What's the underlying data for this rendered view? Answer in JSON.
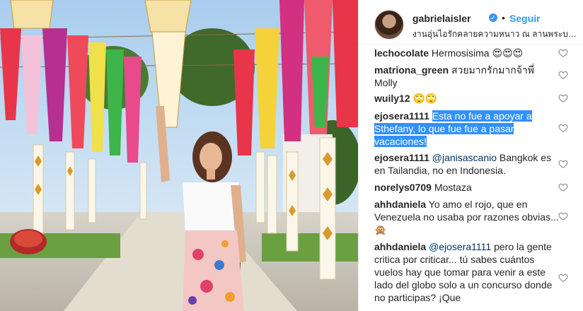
{
  "post": {
    "username": "gabrielaisler",
    "verified_symbol": "✓",
    "separator": "•",
    "follow_label": "Seguir",
    "location": "งานอุ่นไอรักคลายความหนาว ณ ลานพระบรมรู..."
  },
  "comments": [
    {
      "user": "lechocolate",
      "text": "Hermosisima 😍😍😍"
    },
    {
      "user": "matriona_green",
      "text": "สวยมากรักมากจ้าพี่ Molly"
    },
    {
      "user": "wuily12",
      "text": "🙄🙄"
    },
    {
      "user": "ejosera1111",
      "text": "Esta no fue a apoyar a Sthefany, lo que fue fue a pasar vacaciones!"
    },
    {
      "user": "ejosera1111",
      "mention": "@janisascanio",
      "text": "Bangkok es en Tailandia, no en Indonesia."
    },
    {
      "user": "norelys0709",
      "text": "Mostaza"
    },
    {
      "user": "ahhdaniela",
      "text": "Yo amo el rojo, que en Venezuela no usaba por razones obvias... 🙊"
    },
    {
      "user": "ahhdaniela",
      "mention": "@ejosera1111",
      "text": "pero la gente critica por criticar... tú sabes cuántos vuelos hay que tomar para venir a este lado del globo solo a un concurso donde no participas? ¡Que"
    }
  ],
  "icons": {
    "heart": "heart-outline-icon",
    "verified": "verified-badge-icon"
  },
  "colors": {
    "link": "#3897f0",
    "highlight": "#3390ff",
    "text": "#262626"
  }
}
